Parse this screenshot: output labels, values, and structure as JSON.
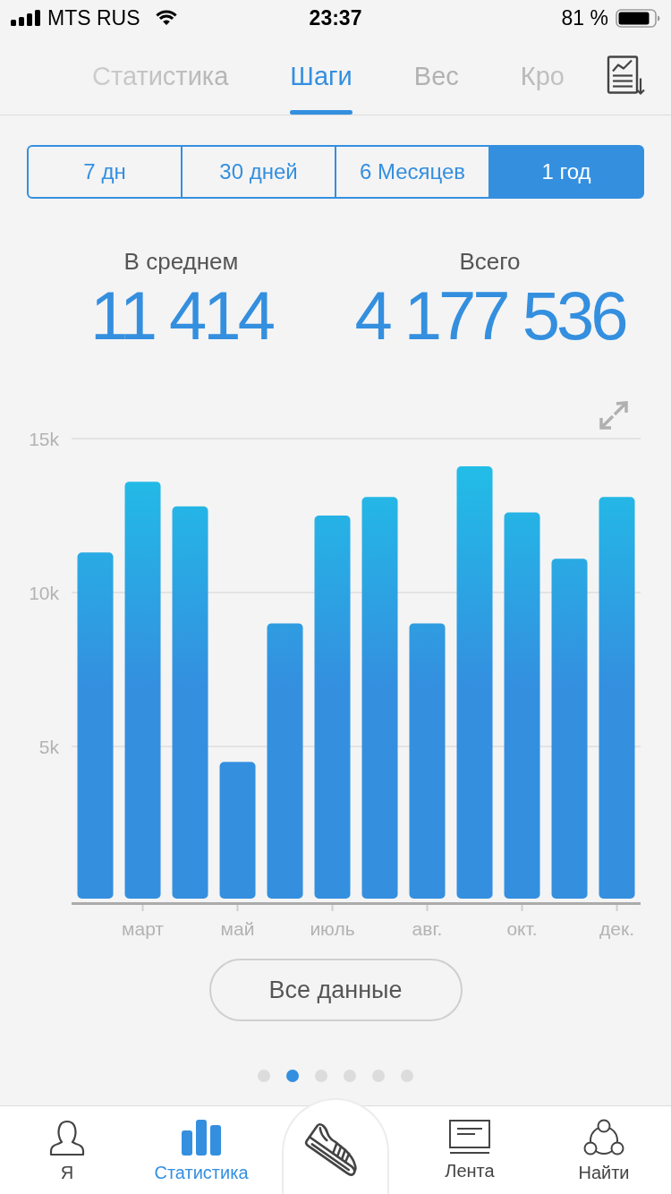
{
  "status_bar": {
    "carrier": "MTS RUS",
    "time": "23:37",
    "battery": "81 %"
  },
  "tabs": [
    {
      "label": "Статистика",
      "selected": false
    },
    {
      "label": "Шаги",
      "selected": true
    },
    {
      "label": "Вес",
      "selected": false
    },
    {
      "label": "Кро",
      "selected": false
    }
  ],
  "periods": [
    {
      "label": "7 дн",
      "selected": false
    },
    {
      "label": "30 дней",
      "selected": false
    },
    {
      "label": "6 Месяцев",
      "selected": false
    },
    {
      "label": "1 год",
      "selected": true
    }
  ],
  "summary": [
    {
      "label": "В среднем",
      "value": "11 414"
    },
    {
      "label": "Всего",
      "value": "4 177 536"
    }
  ],
  "chart": {
    "chart_data": {
      "type": "bar",
      "categories": [
        null,
        "март",
        null,
        "май",
        null,
        "июль",
        null,
        "авг.",
        null,
        "окт.",
        null,
        "дек."
      ],
      "values": [
        11300,
        13600,
        12800,
        4500,
        9000,
        12500,
        13100,
        9000,
        14100,
        12600,
        11100,
        13100
      ],
      "ylim": [
        0,
        15000
      ],
      "yticks": [
        {
          "value": 5000,
          "label": "5k"
        },
        {
          "value": 10000,
          "label": "10k"
        },
        {
          "value": 15000,
          "label": "15k"
        }
      ]
    }
  },
  "all_data_button": {
    "label": "Все данные"
  },
  "pager": [
    {
      "selected": false
    },
    {
      "selected": true
    },
    {
      "selected": false
    },
    {
      "selected": false
    },
    {
      "selected": false
    },
    {
      "selected": false
    }
  ],
  "tab_bar": [
    {
      "kind": "tab",
      "label": "Я",
      "selected": false
    },
    {
      "kind": "tab",
      "label": "Статистика",
      "selected": true
    },
    {
      "kind": "action",
      "selected": false
    },
    {
      "kind": "tab",
      "label": "Лента",
      "selected": false
    },
    {
      "kind": "tab",
      "label": "Найти",
      "selected": false
    }
  ]
}
